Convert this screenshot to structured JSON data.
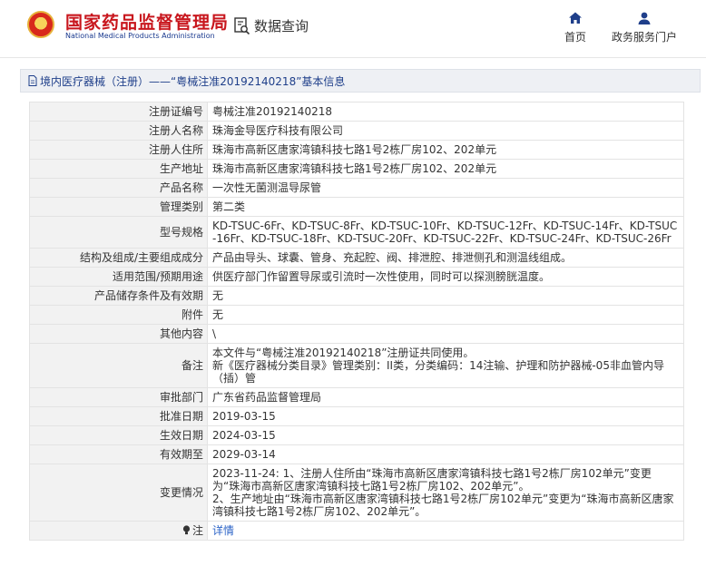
{
  "header": {
    "brand_cn": "国家药品监督管理局",
    "brand_en": "National Medical Products Administration",
    "data_query": "数据查询",
    "nav": [
      {
        "label": "首页",
        "icon": "home-icon"
      },
      {
        "label": "政务服务门户",
        "icon": "user-icon"
      }
    ]
  },
  "title": {
    "text": "境内医疗器械（注册）——“粤械注准20192140218”基本信息"
  },
  "fields": [
    {
      "label": "注册证编号",
      "value": "粤械注准20192140218"
    },
    {
      "label": "注册人名称",
      "value": "珠海金导医疗科技有限公司"
    },
    {
      "label": "注册人住所",
      "value": "珠海市高新区唐家湾镇科技七路1号2栋厂房102、202单元"
    },
    {
      "label": "生产地址",
      "value": "珠海市高新区唐家湾镇科技七路1号2栋厂房102、202单元"
    },
    {
      "label": "产品名称",
      "value": "一次性无菌测温导尿管"
    },
    {
      "label": "管理类别",
      "value": "第二类"
    },
    {
      "label": "型号规格",
      "value": "KD-TSUC-6Fr、KD-TSUC-8Fr、KD-TSUC-10Fr、KD-TSUC-12Fr、KD-TSUC-14Fr、KD-TSUC-16Fr、KD-TSUC-18Fr、KD-TSUC-20Fr、KD-TSUC-22Fr、KD-TSUC-24Fr、KD-TSUC-26Fr"
    },
    {
      "label": "结构及组成/主要组成成分",
      "value": "产品由导头、球囊、管身、充起腔、阀、排泄腔、排泄侧孔和测温线组成。"
    },
    {
      "label": "适用范围/预期用途",
      "value": "供医疗部门作留置导尿或引流时一次性使用，同时可以探测膀胱温度。"
    },
    {
      "label": "产品储存条件及有效期",
      "value": "无"
    },
    {
      "label": "附件",
      "value": "无"
    },
    {
      "label": "其他内容",
      "value": "\\"
    },
    {
      "label": "备注",
      "value": "本文件与“粤械注准20192140218”注册证共同使用。\n新《医疗器械分类目录》管理类别：II类，分类编码：14注输、护理和防护器械-05非血管内导（插）管"
    },
    {
      "label": "审批部门",
      "value": "广东省药品监督管理局"
    },
    {
      "label": "批准日期",
      "value": "2019-03-15"
    },
    {
      "label": "生效日期",
      "value": "2024-03-15"
    },
    {
      "label": "有效期至",
      "value": "2029-03-14"
    },
    {
      "label": "变更情况",
      "value": "2023-11-24: 1、注册人住所由“珠海市高新区唐家湾镇科技七路1号2栋厂房102单元”变更为“珠海市高新区唐家湾镇科技七路1号2栋厂房102、202单元”。\n2、生产地址由“珠海市高新区唐家湾镇科技七路1号2栋厂房102单元”变更为“珠海市高新区唐家湾镇科技七路1号2栋厂房102、202单元”。"
    }
  ],
  "note": {
    "label": "注",
    "link": "详情"
  }
}
